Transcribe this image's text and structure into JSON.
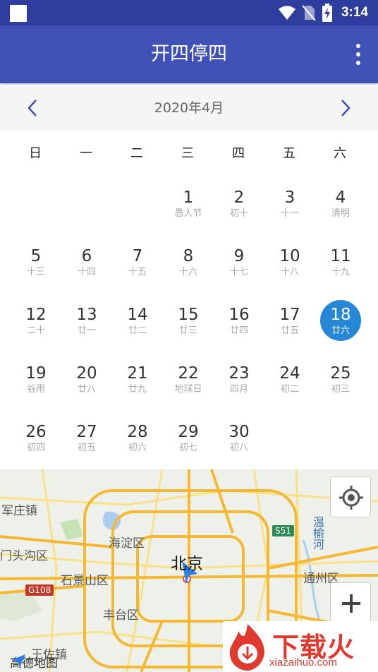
{
  "status_bar": {
    "time": "3:14",
    "icons": [
      "notification-square-icon",
      "wifi-icon",
      "no-sim-icon",
      "battery-charging-icon"
    ]
  },
  "app_bar": {
    "title": "开四停四",
    "menu_icon": "more-vert-icon"
  },
  "month_header": {
    "label": "2020年4月",
    "prev_icon": "chevron-left-icon",
    "next_icon": "chevron-right-icon"
  },
  "weekdays": [
    "日",
    "一",
    "二",
    "三",
    "四",
    "五",
    "六"
  ],
  "calendar": {
    "selected_day": "18",
    "days": [
      {
        "num": "1",
        "lunar": "愚人节",
        "col": 3,
        "row": 0
      },
      {
        "num": "2",
        "lunar": "初十",
        "col": 4,
        "row": 0
      },
      {
        "num": "3",
        "lunar": "十一",
        "col": 5,
        "row": 0
      },
      {
        "num": "4",
        "lunar": "清明",
        "col": 6,
        "row": 0
      },
      {
        "num": "5",
        "lunar": "十三",
        "col": 0,
        "row": 1
      },
      {
        "num": "6",
        "lunar": "十四",
        "col": 1,
        "row": 1
      },
      {
        "num": "7",
        "lunar": "十五",
        "col": 2,
        "row": 1
      },
      {
        "num": "8",
        "lunar": "十六",
        "col": 3,
        "row": 1
      },
      {
        "num": "9",
        "lunar": "十七",
        "col": 4,
        "row": 1
      },
      {
        "num": "10",
        "lunar": "十八",
        "col": 5,
        "row": 1
      },
      {
        "num": "11",
        "lunar": "十九",
        "col": 6,
        "row": 1
      },
      {
        "num": "12",
        "lunar": "二十",
        "col": 0,
        "row": 2
      },
      {
        "num": "13",
        "lunar": "廿一",
        "col": 1,
        "row": 2
      },
      {
        "num": "14",
        "lunar": "廿二",
        "col": 2,
        "row": 2
      },
      {
        "num": "15",
        "lunar": "廿三",
        "col": 3,
        "row": 2
      },
      {
        "num": "16",
        "lunar": "廿四",
        "col": 4,
        "row": 2
      },
      {
        "num": "17",
        "lunar": "廿五",
        "col": 5,
        "row": 2
      },
      {
        "num": "18",
        "lunar": "廿六",
        "col": 6,
        "row": 2
      },
      {
        "num": "19",
        "lunar": "谷雨",
        "col": 0,
        "row": 3
      },
      {
        "num": "20",
        "lunar": "廿八",
        "col": 1,
        "row": 3
      },
      {
        "num": "21",
        "lunar": "廿九",
        "col": 2,
        "row": 3
      },
      {
        "num": "22",
        "lunar": "地球日",
        "col": 3,
        "row": 3
      },
      {
        "num": "23",
        "lunar": "四月",
        "col": 4,
        "row": 3
      },
      {
        "num": "24",
        "lunar": "初二",
        "col": 5,
        "row": 3
      },
      {
        "num": "25",
        "lunar": "初三",
        "col": 6,
        "row": 3
      },
      {
        "num": "26",
        "lunar": "初四",
        "col": 0,
        "row": 4
      },
      {
        "num": "27",
        "lunar": "初五",
        "col": 1,
        "row": 4
      },
      {
        "num": "28",
        "lunar": "初六",
        "col": 2,
        "row": 4
      },
      {
        "num": "29",
        "lunar": "初七",
        "col": 3,
        "row": 4
      },
      {
        "num": "30",
        "lunar": "初八",
        "col": 4,
        "row": 4
      }
    ]
  },
  "map": {
    "center_label": "北京",
    "labels": {
      "junzhuangzhen": "军庄镇",
      "mentougou": "门头沟区",
      "haidian": "海淀区",
      "shijingshan": "石景山区",
      "fengtai": "丰台区",
      "tongzhou": "通州区",
      "wangzuozhen": "王佐镇",
      "wenyu_river": "温榆河",
      "road_g108": "G108",
      "road_s51": "S51"
    },
    "locate_icon": "crosshair-locate-icon",
    "zoom_in_icon": "plus-icon",
    "logo": "高德地图",
    "colors": {
      "major_road": "#f5b833",
      "minor_road": "#fbe08a",
      "water": "#a8cdf0",
      "park": "#c7e3b4"
    }
  },
  "watermark": {
    "title": "下载火",
    "url": "xiazaihuo.com"
  }
}
